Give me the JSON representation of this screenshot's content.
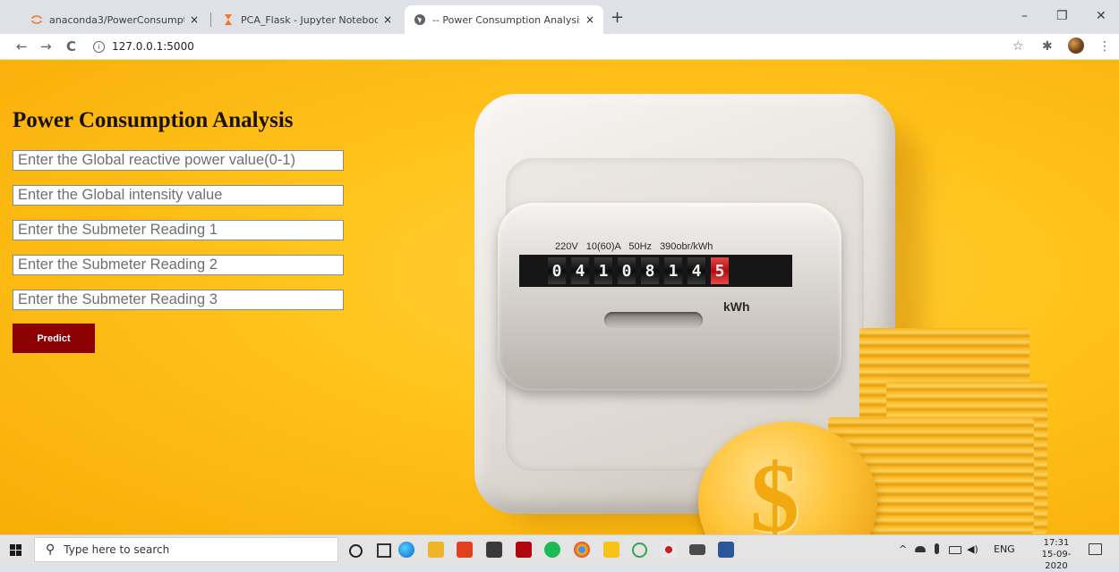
{
  "browser": {
    "tabs": [
      {
        "title": "anaconda3/PowerConsumptionA",
        "active": false
      },
      {
        "title": "PCA_Flask - Jupyter Notebook",
        "active": false
      },
      {
        "title": "-- Power Consumption Analysis",
        "active": true
      }
    ],
    "tab_close": "×",
    "new_tab": "+",
    "url": "127.0.0.1:5000",
    "window_controls": {
      "minimize": "–",
      "restore": "❐",
      "close": "✕"
    },
    "nav": {
      "back": "←",
      "forward": "→",
      "reload": "C"
    },
    "toolbar_icons": {
      "star": "☆",
      "extensions": "✱",
      "menu": "⋮"
    }
  },
  "page": {
    "title": "Power Consumption Analysis",
    "fields": [
      {
        "placeholder": "Enter the Global reactive power value(0-1)"
      },
      {
        "placeholder": "Enter the Global intensity value"
      },
      {
        "placeholder": "Enter the Submeter Reading 1"
      },
      {
        "placeholder": "Enter the Submeter Reading 2"
      },
      {
        "placeholder": "Enter the Submeter Reading 3"
      }
    ],
    "predict_label": "Predict"
  },
  "meter": {
    "spec_label": "220V 10(60)A 50Hz 390obr/kWh",
    "digits": [
      "0",
      "4",
      "1",
      "0",
      "8",
      "1",
      "4"
    ],
    "red_digit": "5",
    "unit": "kWh",
    "coin_symbol": "$"
  },
  "taskbar": {
    "search_placeholder": "Type here to search",
    "lang": "ENG",
    "time": "17:31",
    "date": "15-09-2020"
  },
  "colors": {
    "predict_button": "#8b0000",
    "background": "#ffc21a",
    "title": "#1a1208"
  }
}
